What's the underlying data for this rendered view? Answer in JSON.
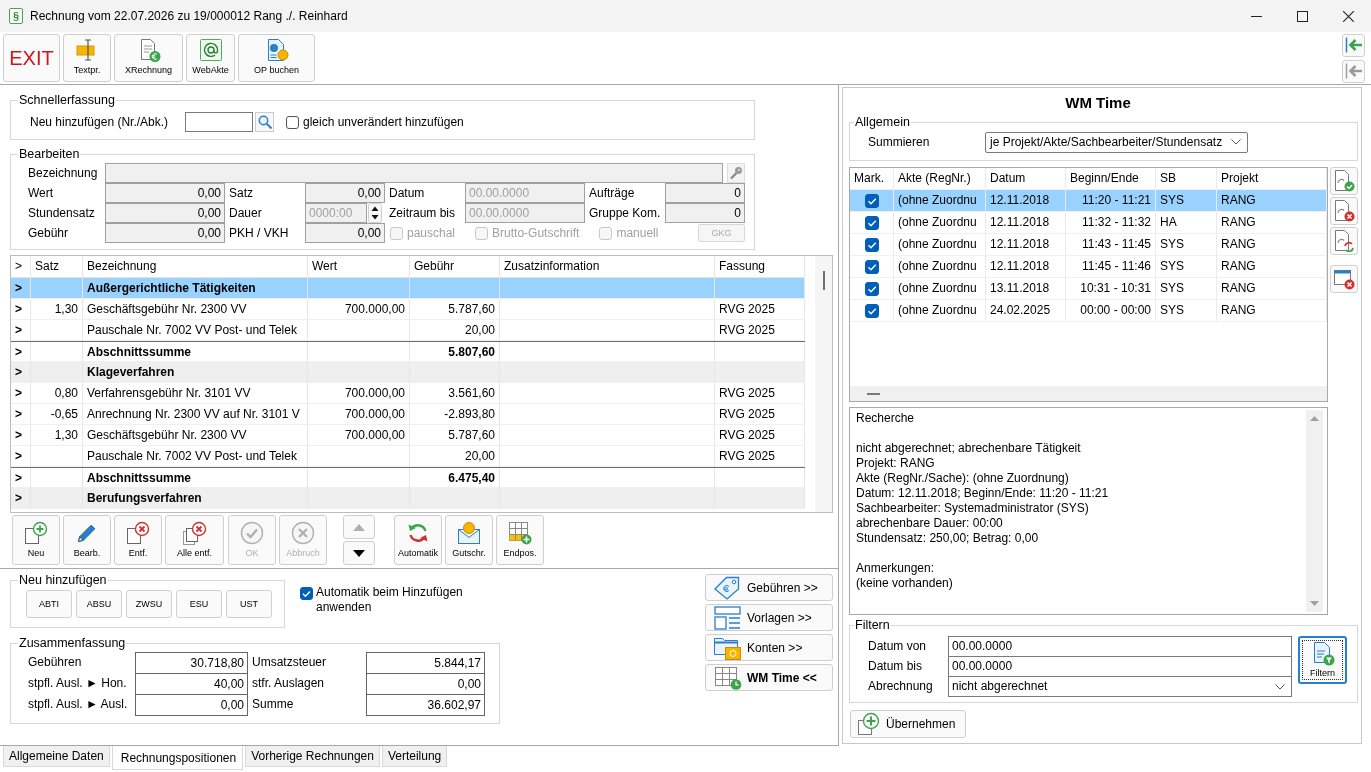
{
  "window": {
    "app_glyph": "§",
    "title": "Rechnung vom 22.07.2026 zu 19/000012 Rang ./. Reinhard"
  },
  "toolbar": [
    {
      "kind": "exit",
      "label": "EXIT"
    },
    {
      "kind": "textpr",
      "label": "Textpr."
    },
    {
      "kind": "xrechnung",
      "label": "XRechnung"
    },
    {
      "kind": "webakte",
      "label": "WebAkte"
    },
    {
      "kind": "op",
      "label": "OP buchen"
    }
  ],
  "side_arrows": [
    {
      "disabled": false
    },
    {
      "disabled": true
    }
  ],
  "schnellerfassung": {
    "title": "Schnellerfassung",
    "label": "Neu hinzufügen (Nr./Abk.)",
    "checkbox": {
      "label": "gleich unverändert hinzufügen",
      "checked": false
    }
  },
  "bearbeiten": {
    "title": "Bearbeiten",
    "bezeichnung_label": "Bezeichnung",
    "fields": [
      {
        "label": "Wert",
        "value": "0,00",
        "kind": "number",
        "disabled": false
      },
      {
        "label": "Satz",
        "value": "0,00",
        "kind": "number",
        "disabled": false
      },
      {
        "label": "Datum",
        "value": "00.00.0000",
        "kind": "date",
        "disabled": true
      },
      {
        "label": "Aufträge",
        "value": "0",
        "kind": "number",
        "disabled": false
      },
      {
        "label": "Stundensatz",
        "value": "0,00",
        "kind": "number",
        "disabled": false
      },
      {
        "label": "Dauer",
        "value": "0000:00",
        "kind": "spin",
        "disabled": true
      },
      {
        "label": "Zeitraum bis",
        "value": "00.00.0000",
        "kind": "date",
        "disabled": true
      },
      {
        "label": "Gruppe Kom.",
        "value": "0",
        "kind": "number",
        "disabled": false
      },
      {
        "label": "Gebühr",
        "value": "0,00",
        "kind": "number",
        "disabled": false
      },
      {
        "label": "PKH / VKH",
        "value": "0,00",
        "kind": "number",
        "disabled": false
      }
    ],
    "options": [
      {
        "label": "pauschal",
        "checked": false,
        "disabled": true
      },
      {
        "label": "Brutto-Gutschrift",
        "checked": false,
        "disabled": true
      },
      {
        "label": "manuell",
        "checked": false,
        "disabled": true
      }
    ],
    "gkg": {
      "label": "GKG",
      "disabled": true
    }
  },
  "positions": {
    "columns": [
      ">",
      "Satz",
      "Bezeichnung",
      "Wert",
      "Gebühr",
      "Zusatzinformation",
      "Fassung"
    ],
    "rows": [
      {
        "kind": "group",
        "selected": true,
        "marker": ">",
        "bezeichnung": "Außergerichtliche Tätigkeiten"
      },
      {
        "kind": "item",
        "selected": false,
        "marker": ">",
        "satz": "1,30",
        "bezeichnung": "Geschäftsgebühr Nr. 2300 VV",
        "wert": "700.000,00",
        "gebuehr": "5.787,60",
        "fassung": "RVG 2025"
      },
      {
        "kind": "item",
        "selected": false,
        "marker": ">",
        "bezeichnung": "Pauschale Nr. 7002 VV Post- und Telek",
        "gebuehr": "20,00",
        "fassung": "RVG 2025"
      },
      {
        "kind": "sum",
        "selected": false,
        "marker": ">",
        "bezeichnung": "Abschnittssumme",
        "gebuehr": "5.807,60"
      },
      {
        "kind": "group",
        "selected": false,
        "marker": ">",
        "bezeichnung": "Klageverfahren"
      },
      {
        "kind": "item",
        "selected": false,
        "marker": ">",
        "satz": "0,80",
        "bezeichnung": "Verfahrensgebühr Nr. 3101 VV",
        "wert": "700.000,00",
        "gebuehr": "3.561,60",
        "fassung": "RVG 2025"
      },
      {
        "kind": "item",
        "selected": false,
        "marker": ">",
        "satz": "-0,65",
        "bezeichnung": "Anrechnung Nr. 2300 VV auf Nr. 3101 V",
        "wert": "700.000,00",
        "gebuehr": "-2.893,80",
        "fassung": "RVG 2025"
      },
      {
        "kind": "item",
        "selected": false,
        "marker": ">",
        "satz": "1,30",
        "bezeichnung": "Geschäftsgebühr Nr. 2300 VV",
        "wert": "700.000,00",
        "gebuehr": "5.787,60",
        "fassung": "RVG 2025"
      },
      {
        "kind": "item",
        "selected": false,
        "marker": ">",
        "bezeichnung": "Pauschale Nr. 7002 VV Post- und Telek",
        "gebuehr": "20,00",
        "fassung": "RVG 2025"
      },
      {
        "kind": "sum",
        "selected": false,
        "marker": ">",
        "bezeichnung": "Abschnittssumme",
        "gebuehr": "6.475,40"
      },
      {
        "kind": "group",
        "selected": false,
        "marker": ">",
        "bezeichnung": "Berufungsverfahren"
      }
    ]
  },
  "row_buttons": [
    {
      "kind": "neu",
      "label": "Neu",
      "disabled": false
    },
    {
      "kind": "bearb",
      "label": "Bearb.",
      "disabled": false
    },
    {
      "kind": "entf",
      "label": "Entf.",
      "disabled": false
    },
    {
      "kind": "alle_entf",
      "label": "Alle entf.",
      "disabled": false
    },
    {
      "kind": "ok",
      "label": "OK",
      "disabled": true
    },
    {
      "kind": "abbruch",
      "label": "Abbruch",
      "disabled": true
    },
    {
      "kind": "up",
      "disabled": true
    },
    {
      "kind": "down",
      "disabled": false
    },
    {
      "kind": "automatik",
      "label": "Automatik",
      "disabled": false
    },
    {
      "kind": "gutschr",
      "label": "Gutschr.",
      "disabled": false
    },
    {
      "kind": "endpos",
      "label": "Endpos.",
      "disabled": false
    }
  ],
  "neu_hinzufuegen": {
    "title": "Neu hinzufügen",
    "buttons": [
      "ABTI",
      "ABSU",
      "ZWSU",
      "ESU",
      "UST"
    ]
  },
  "auto_checkbox": {
    "label": "Automatik beim Hinzufügen anwenden",
    "checked": true
  },
  "zusammenfassung": {
    "title": "Zusammenfassung",
    "items": [
      {
        "label": "Gebühren",
        "value": "30.718,80"
      },
      {
        "label": "Umsatzsteuer",
        "value": "5.844,17"
      },
      {
        "label": "stpfl. Ausl. ► Hon.",
        "value": "40,00"
      },
      {
        "label": "stfr. Auslagen",
        "value": "0,00"
      },
      {
        "label": "stpfl. Ausl. ► Ausl.",
        "value": "0,00"
      },
      {
        "label": "Summe",
        "value": "36.602,97"
      }
    ]
  },
  "nav_buttons": [
    {
      "kind": "gebuehren",
      "label": "Gebühren >>",
      "active": false
    },
    {
      "kind": "vorlagen",
      "label": "Vorlagen >>",
      "active": false
    },
    {
      "kind": "konten",
      "label": "Konten >>",
      "active": false
    },
    {
      "kind": "wmtime",
      "label": "WM Time <<",
      "active": true
    }
  ],
  "wm_time": {
    "title": "WM Time",
    "allgemein": {
      "title": "Allgemein",
      "label": "Summieren",
      "value": "je Projekt/Akte/Sachbearbeiter/Stundensatz"
    },
    "table": {
      "columns": [
        "Mark.",
        "Akte (RegNr.)",
        "Datum",
        "Beginn/Ende",
        "SB",
        "Projekt"
      ],
      "rows": [
        {
          "checked": true,
          "selected": true,
          "akte": "(ohne Zuordnu",
          "datum": "12.11.2018",
          "zeit": "11:20 - 11:21",
          "sb": "SYS",
          "projekt": "RANG"
        },
        {
          "checked": true,
          "selected": false,
          "akte": "(ohne Zuordnu",
          "datum": "12.11.2018",
          "zeit": "11:32 - 11:32",
          "sb": "HA",
          "projekt": "RANG"
        },
        {
          "checked": true,
          "selected": false,
          "akte": "(ohne Zuordnu",
          "datum": "12.11.2018",
          "zeit": "11:43 - 11:45",
          "sb": "SYS",
          "projekt": "RANG"
        },
        {
          "checked": true,
          "selected": false,
          "akte": "(ohne Zuordnu",
          "datum": "12.11.2018",
          "zeit": "11:45 - 11:46",
          "sb": "SYS",
          "projekt": "RANG"
        },
        {
          "checked": true,
          "selected": false,
          "akte": "(ohne Zuordnu",
          "datum": "13.11.2018",
          "zeit": "10:31 - 10:31",
          "sb": "SYS",
          "projekt": "RANG"
        },
        {
          "checked": true,
          "selected": false,
          "akte": "(ohne Zuordnu",
          "datum": "24.02.2025",
          "zeit": "00:00 - 00:00",
          "sb": "SYS",
          "projekt": "RANG"
        }
      ]
    },
    "side_buttons": [
      {
        "kind": "doc_check"
      },
      {
        "kind": "doc_x"
      },
      {
        "kind": "doc_refresh"
      },
      {
        "kind": "window_x"
      }
    ],
    "recherche": [
      [
        "Recherche"
      ],
      [
        "nicht abgerechnet; abrechenbare Tätigkeit",
        "Projekt: RANG",
        "Akte (RegNr./Sache): (ohne Zuordnung)",
        "Datum: 12.11.2018; Beginn/Ende: 11:20 - 11:21",
        "Sachbearbeiter: Systemadministrator (SYS)",
        "abrechenbare Dauer: 00:00",
        "Stundensatz: 250,00; Betrag: 0,00"
      ],
      [
        "Anmerkungen:",
        "(keine vorhanden)"
      ]
    ],
    "filter": {
      "title": "Filtern",
      "fields": [
        {
          "label": "Datum von",
          "value": "00.00.0000",
          "kind": "input"
        },
        {
          "label": "Datum bis",
          "value": "00.00.0000",
          "kind": "input"
        },
        {
          "label": "Abrechnung",
          "value": "nicht abgerechnet",
          "kind": "select"
        }
      ],
      "button": {
        "label": "Filtern",
        "focused": true
      }
    },
    "apply_button": "Übernehmen"
  },
  "tabs": [
    {
      "label": "Allgemeine Daten",
      "selected": false
    },
    {
      "label": "Rechnungspositionen",
      "selected": true
    },
    {
      "label": "Vorherige Rechnungen",
      "selected": false
    },
    {
      "label": "Verteilung",
      "selected": false
    }
  ]
}
